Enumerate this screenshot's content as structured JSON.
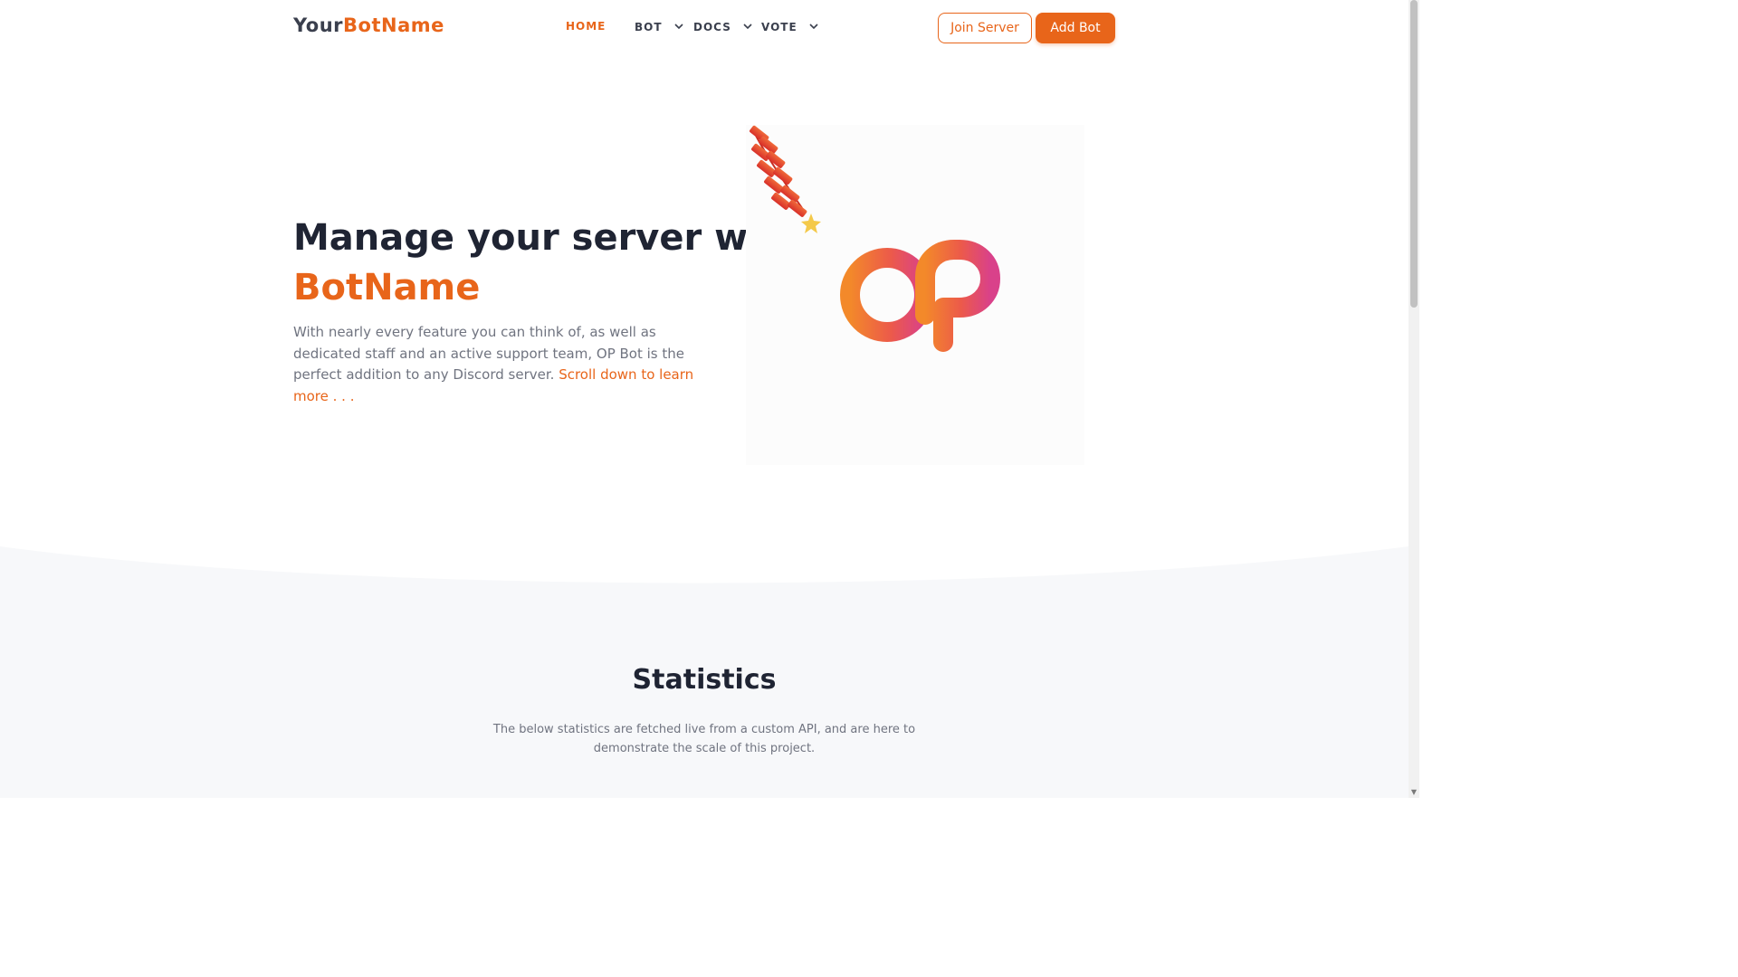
{
  "brand": {
    "prefix": "Your",
    "accent": "BotName"
  },
  "nav": {
    "items": [
      {
        "label": "HOME",
        "active": true,
        "dropdown": false
      },
      {
        "label": "BOT",
        "active": false,
        "dropdown": true
      },
      {
        "label": "DOCS",
        "active": false,
        "dropdown": true
      },
      {
        "label": "VOTE",
        "active": false,
        "dropdown": true
      }
    ],
    "join_label": "Join Server",
    "add_label": "Add Bot"
  },
  "hero": {
    "title_line1": "Manage your server with",
    "title_accent": "BotName",
    "text": "With nearly every feature you can think of, as well as dedicated staff and an active support team, OP Bot is the perfect addition to any Discord server.",
    "link_text": "Scroll down to learn more . . .",
    "logo_text": "OP"
  },
  "stats": {
    "title": "Statistics",
    "text": "The below statistics are fetched live from a custom API, and are here to demonstrate the scale of this project."
  },
  "colors": {
    "accent": "#e8651a",
    "text_dark": "#1f2433",
    "text_muted": "#707480",
    "section_bg": "#f7f8fa"
  }
}
